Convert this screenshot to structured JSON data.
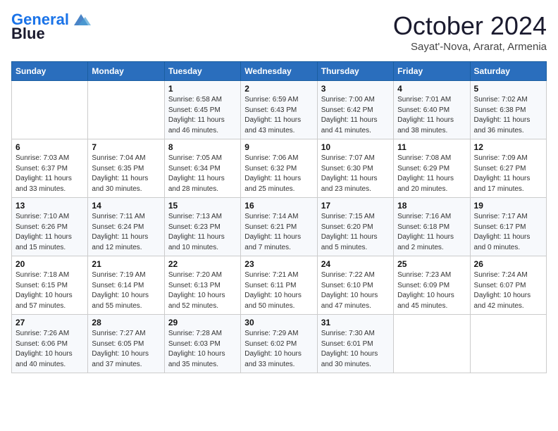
{
  "header": {
    "logo_line1": "General",
    "logo_line2": "Blue",
    "month_title": "October 2024",
    "location": "Sayat'-Nova, Ararat, Armenia"
  },
  "weekdays": [
    "Sunday",
    "Monday",
    "Tuesday",
    "Wednesday",
    "Thursday",
    "Friday",
    "Saturday"
  ],
  "weeks": [
    [
      {
        "day": "",
        "info": ""
      },
      {
        "day": "",
        "info": ""
      },
      {
        "day": "1",
        "info": "Sunrise: 6:58 AM\nSunset: 6:45 PM\nDaylight: 11 hours and 46 minutes."
      },
      {
        "day": "2",
        "info": "Sunrise: 6:59 AM\nSunset: 6:43 PM\nDaylight: 11 hours and 43 minutes."
      },
      {
        "day": "3",
        "info": "Sunrise: 7:00 AM\nSunset: 6:42 PM\nDaylight: 11 hours and 41 minutes."
      },
      {
        "day": "4",
        "info": "Sunrise: 7:01 AM\nSunset: 6:40 PM\nDaylight: 11 hours and 38 minutes."
      },
      {
        "day": "5",
        "info": "Sunrise: 7:02 AM\nSunset: 6:38 PM\nDaylight: 11 hours and 36 minutes."
      }
    ],
    [
      {
        "day": "6",
        "info": "Sunrise: 7:03 AM\nSunset: 6:37 PM\nDaylight: 11 hours and 33 minutes."
      },
      {
        "day": "7",
        "info": "Sunrise: 7:04 AM\nSunset: 6:35 PM\nDaylight: 11 hours and 30 minutes."
      },
      {
        "day": "8",
        "info": "Sunrise: 7:05 AM\nSunset: 6:34 PM\nDaylight: 11 hours and 28 minutes."
      },
      {
        "day": "9",
        "info": "Sunrise: 7:06 AM\nSunset: 6:32 PM\nDaylight: 11 hours and 25 minutes."
      },
      {
        "day": "10",
        "info": "Sunrise: 7:07 AM\nSunset: 6:30 PM\nDaylight: 11 hours and 23 minutes."
      },
      {
        "day": "11",
        "info": "Sunrise: 7:08 AM\nSunset: 6:29 PM\nDaylight: 11 hours and 20 minutes."
      },
      {
        "day": "12",
        "info": "Sunrise: 7:09 AM\nSunset: 6:27 PM\nDaylight: 11 hours and 17 minutes."
      }
    ],
    [
      {
        "day": "13",
        "info": "Sunrise: 7:10 AM\nSunset: 6:26 PM\nDaylight: 11 hours and 15 minutes."
      },
      {
        "day": "14",
        "info": "Sunrise: 7:11 AM\nSunset: 6:24 PM\nDaylight: 11 hours and 12 minutes."
      },
      {
        "day": "15",
        "info": "Sunrise: 7:13 AM\nSunset: 6:23 PM\nDaylight: 11 hours and 10 minutes."
      },
      {
        "day": "16",
        "info": "Sunrise: 7:14 AM\nSunset: 6:21 PM\nDaylight: 11 hours and 7 minutes."
      },
      {
        "day": "17",
        "info": "Sunrise: 7:15 AM\nSunset: 6:20 PM\nDaylight: 11 hours and 5 minutes."
      },
      {
        "day": "18",
        "info": "Sunrise: 7:16 AM\nSunset: 6:18 PM\nDaylight: 11 hours and 2 minutes."
      },
      {
        "day": "19",
        "info": "Sunrise: 7:17 AM\nSunset: 6:17 PM\nDaylight: 11 hours and 0 minutes."
      }
    ],
    [
      {
        "day": "20",
        "info": "Sunrise: 7:18 AM\nSunset: 6:15 PM\nDaylight: 10 hours and 57 minutes."
      },
      {
        "day": "21",
        "info": "Sunrise: 7:19 AM\nSunset: 6:14 PM\nDaylight: 10 hours and 55 minutes."
      },
      {
        "day": "22",
        "info": "Sunrise: 7:20 AM\nSunset: 6:13 PM\nDaylight: 10 hours and 52 minutes."
      },
      {
        "day": "23",
        "info": "Sunrise: 7:21 AM\nSunset: 6:11 PM\nDaylight: 10 hours and 50 minutes."
      },
      {
        "day": "24",
        "info": "Sunrise: 7:22 AM\nSunset: 6:10 PM\nDaylight: 10 hours and 47 minutes."
      },
      {
        "day": "25",
        "info": "Sunrise: 7:23 AM\nSunset: 6:09 PM\nDaylight: 10 hours and 45 minutes."
      },
      {
        "day": "26",
        "info": "Sunrise: 7:24 AM\nSunset: 6:07 PM\nDaylight: 10 hours and 42 minutes."
      }
    ],
    [
      {
        "day": "27",
        "info": "Sunrise: 7:26 AM\nSunset: 6:06 PM\nDaylight: 10 hours and 40 minutes."
      },
      {
        "day": "28",
        "info": "Sunrise: 7:27 AM\nSunset: 6:05 PM\nDaylight: 10 hours and 37 minutes."
      },
      {
        "day": "29",
        "info": "Sunrise: 7:28 AM\nSunset: 6:03 PM\nDaylight: 10 hours and 35 minutes."
      },
      {
        "day": "30",
        "info": "Sunrise: 7:29 AM\nSunset: 6:02 PM\nDaylight: 10 hours and 33 minutes."
      },
      {
        "day": "31",
        "info": "Sunrise: 7:30 AM\nSunset: 6:01 PM\nDaylight: 10 hours and 30 minutes."
      },
      {
        "day": "",
        "info": ""
      },
      {
        "day": "",
        "info": ""
      }
    ]
  ]
}
